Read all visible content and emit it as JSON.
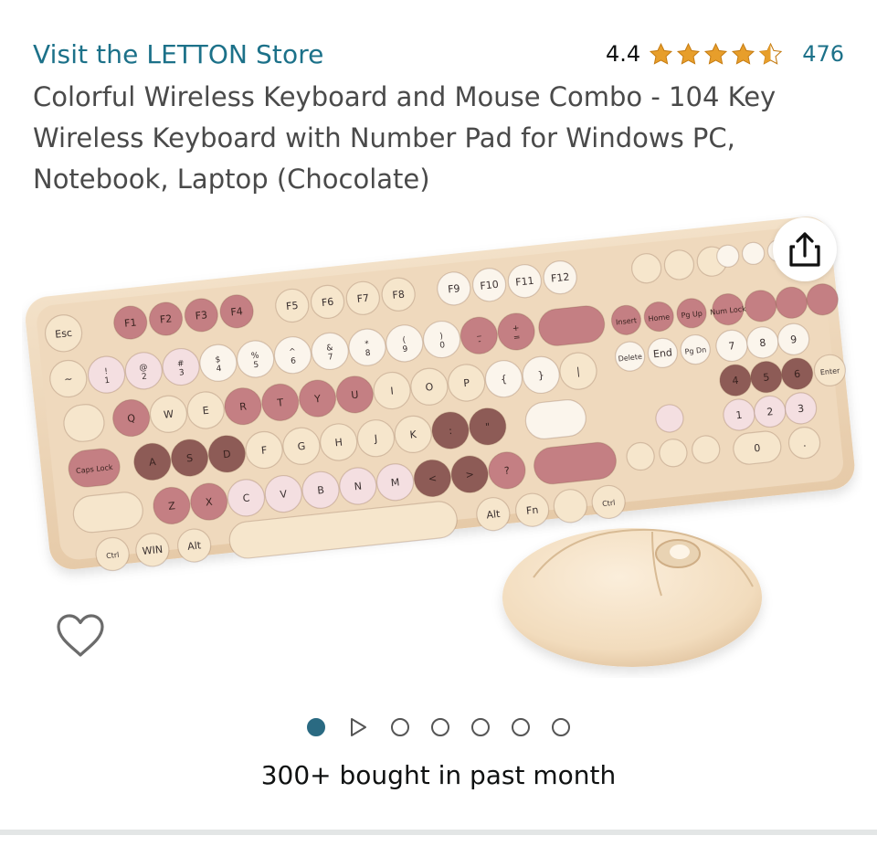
{
  "store": {
    "link_text": "Visit the LETTON Store"
  },
  "rating": {
    "value": "4.4",
    "stars": 4.4,
    "count": "476"
  },
  "product": {
    "title": "Colorful Wireless Keyboard and Mouse Combo - 104 Key Wireless Keyboard with Number Pad for Windows PC, Notebook, Laptop (Chocolate)"
  },
  "keyboard": {
    "fkeys": [
      "F1",
      "F2",
      "F3",
      "F4",
      "F5",
      "F6",
      "F7",
      "F8",
      "F9",
      "F10",
      "F11",
      "F12"
    ],
    "row1": [
      "!\n1",
      "@\n2",
      "#\n3",
      "$\n4",
      "%\n5",
      "^\n6",
      "&\n7",
      "*\n8",
      "(\n9",
      ")\n0",
      "_\n-",
      "+\n="
    ],
    "row2": [
      "Q",
      "W",
      "E",
      "R",
      "T",
      "Y",
      "U",
      "I",
      "O",
      "P",
      "{",
      "}"
    ],
    "row3": [
      "A",
      "S",
      "D",
      "F",
      "G",
      "H",
      "J",
      "K",
      ":",
      "\""
    ],
    "row4": [
      "Z",
      "X",
      "C",
      "V",
      "B",
      "N",
      "M",
      "<",
      ">",
      "?"
    ],
    "labels": {
      "esc": "Esc",
      "caps": "Caps Lock",
      "ctrl": "Ctrl",
      "win": "WIN",
      "alt": "Alt",
      "fn": "Fn",
      "enter": "Enter",
      "numlock": "Num Lock",
      "insert": "Insert",
      "home": "Home",
      "pgup": "Pg Up",
      "delete": "Delete",
      "end": "End",
      "pgdn": "Pg Dn"
    }
  },
  "carousel": {
    "total_images": 6,
    "active_index": 0,
    "has_video": true
  },
  "social_proof": {
    "text": "300+ bought in past month"
  },
  "icons": {
    "share": "share-icon",
    "wishlist": "heart-icon",
    "star": "star-icon",
    "play": "play-icon"
  },
  "colors": {
    "link": "#1c7189",
    "star": "#e79e2b",
    "active_dot": "#2a6a82",
    "key_cream": "#f6e6cc",
    "key_pink": "#c47f83",
    "key_light_pink": "#f4dfe1",
    "key_brown": "#8d5b56",
    "keyboard_body": "#eed8bd"
  }
}
